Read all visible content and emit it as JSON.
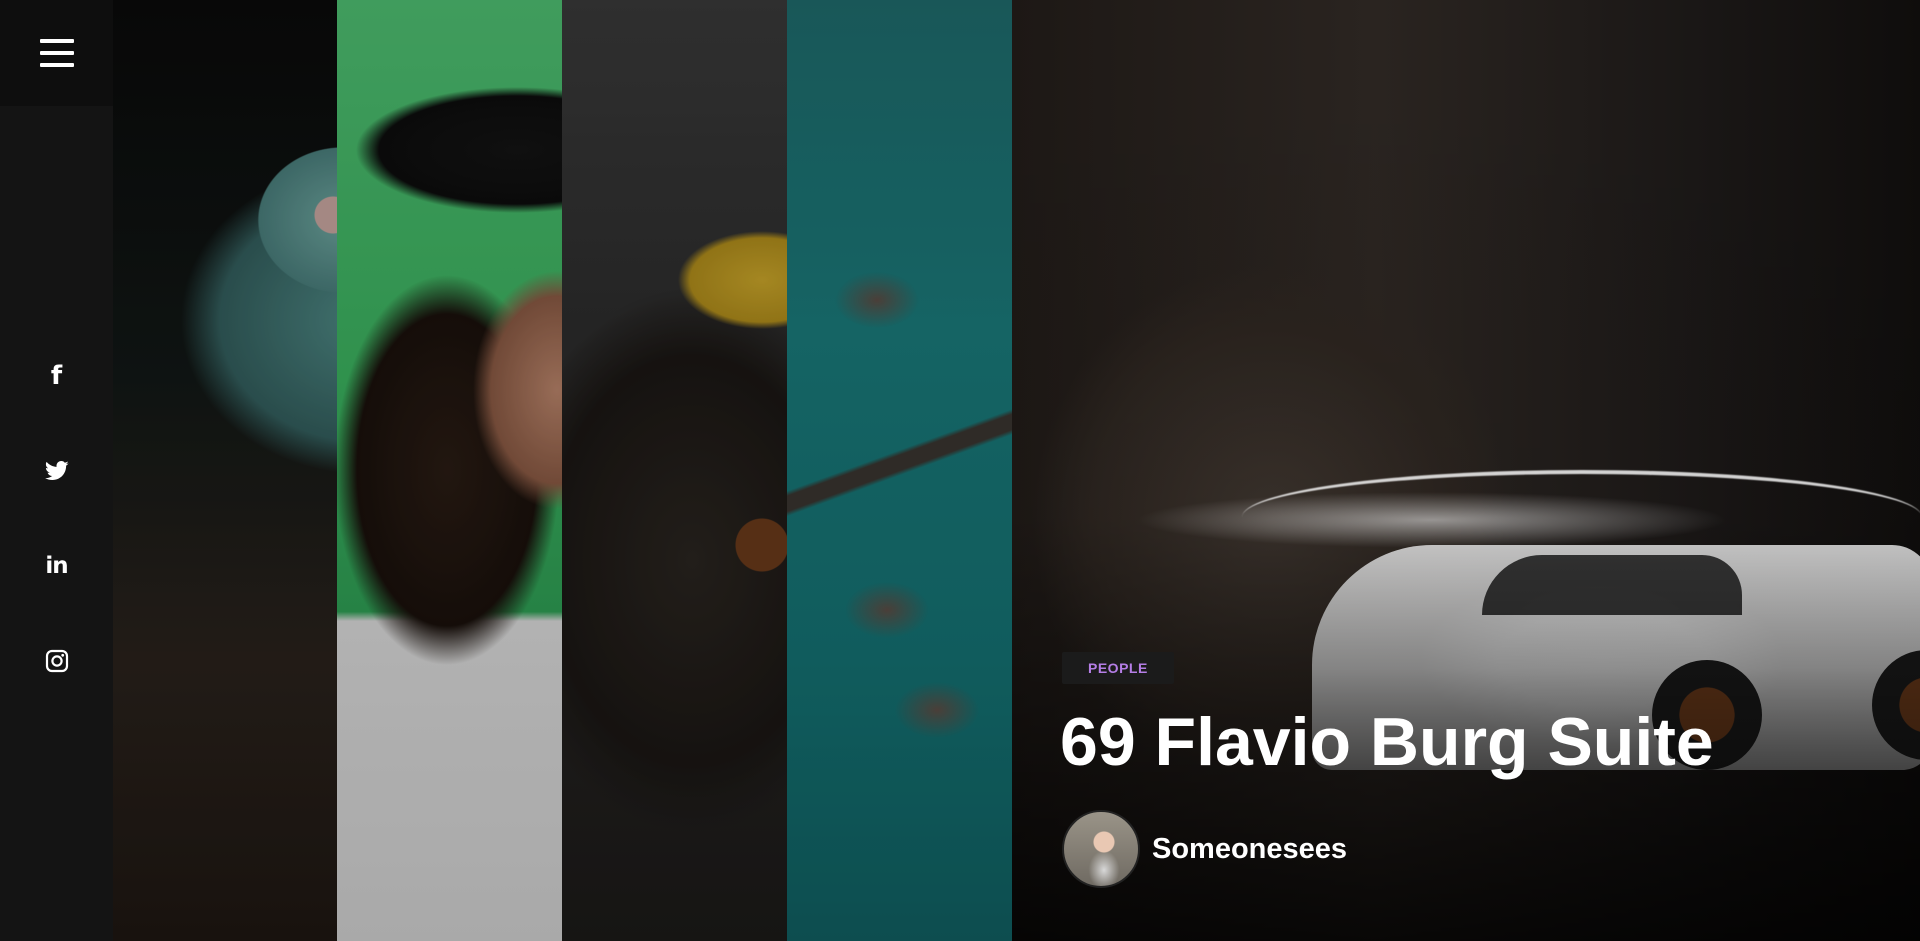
{
  "sidebar": {
    "menu_icon": "hamburger-menu-icon",
    "social": [
      {
        "name": "facebook",
        "icon": "facebook-icon",
        "glyph": "f"
      },
      {
        "name": "twitter",
        "icon": "twitter-icon",
        "glyph": ""
      },
      {
        "name": "linkedin",
        "icon": "linkedin-icon",
        "glyph": "in"
      },
      {
        "name": "instagram",
        "icon": "instagram-icon",
        "glyph": ""
      }
    ]
  },
  "hero": {
    "tag": "PEOPLE",
    "title": "69 Flavio Burg Suite",
    "author": "Someonesees"
  },
  "colors": {
    "sidebar_bg": "#141414",
    "tag_text": "#b57ee6",
    "tag_bg": "#1b1b1b",
    "title_text": "#ffffff"
  }
}
